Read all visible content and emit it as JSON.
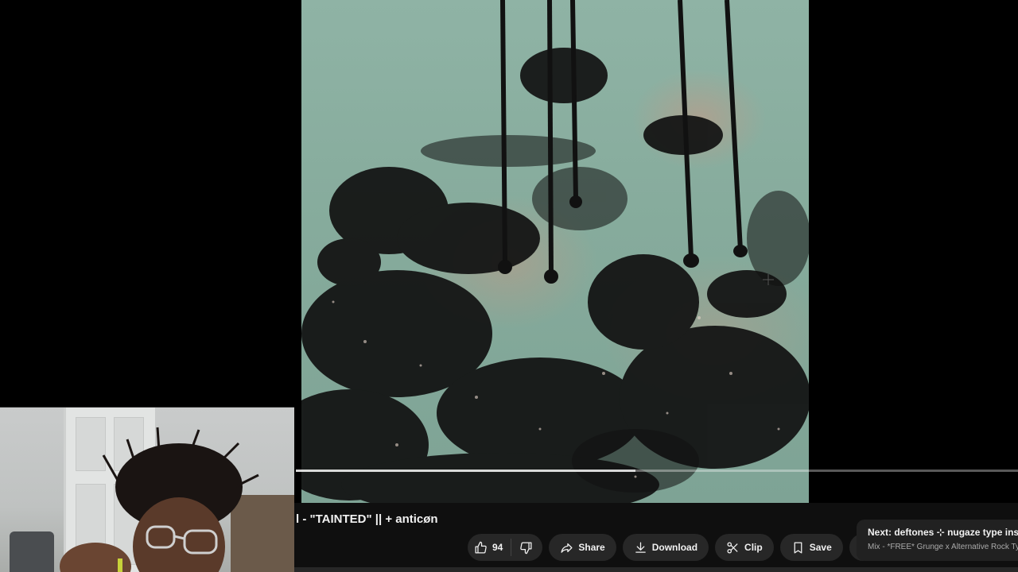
{
  "video": {
    "title": "l - \"TAINTED\" || + anticøn",
    "progress_fraction": 0.47
  },
  "actions": {
    "like_count": "94",
    "share_label": "Share",
    "download_label": "Download",
    "clip_label": "Clip",
    "save_label": "Save"
  },
  "next_card": {
    "title": "Next: deftones ⊹ nugaze type instrum",
    "subtitle": "Mix - *FREE* Grunge x Alternative Rock Type"
  },
  "icons": [
    "like-icon",
    "dislike-icon",
    "share-icon",
    "download-icon",
    "clip-icon",
    "save-icon",
    "more-icon"
  ],
  "colors": {
    "background": "#0f0f0f",
    "pill": "#272727",
    "text": "#f1f1f1",
    "subtext": "#aaaaaa"
  }
}
